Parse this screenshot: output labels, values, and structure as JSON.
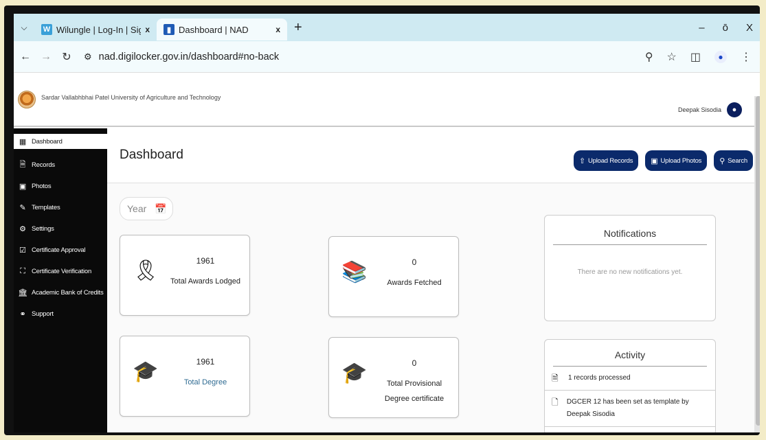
{
  "browser": {
    "tabs": [
      {
        "title": "Wilungle | Log-In | Sign-Up",
        "close": "x",
        "active": false
      },
      {
        "title": "Dashboard | NAD",
        "close": "x",
        "active": true
      }
    ],
    "new_tab": "+",
    "window_controls": [
      "–",
      "ō",
      "X"
    ],
    "url": "nad.digilocker.gov.in/dashboard#no-back"
  },
  "header": {
    "university": "Sardar Vallabhbhai Patel University of Agriculture and Technology",
    "user_name": "Deepak Sisodia"
  },
  "sidebar": {
    "items": [
      {
        "label": "Dashboard",
        "icon": "dashboard-icon",
        "active": true
      },
      {
        "label": "Records",
        "icon": "file-icon"
      },
      {
        "label": "Photos",
        "icon": "image-icon"
      },
      {
        "label": "Templates",
        "icon": "pencil-icon"
      },
      {
        "label": "Settings",
        "icon": "gear-icon"
      },
      {
        "label": "Certificate Approval",
        "icon": "certificate-icon"
      },
      {
        "label": "Certificate Verification",
        "icon": "verify-icon"
      },
      {
        "label": "Academic Bank of Credits",
        "icon": "bank-icon"
      },
      {
        "label": "Support",
        "icon": "headset-icon"
      }
    ]
  },
  "main": {
    "title": "Dashboard",
    "actions": {
      "upload_records": "Upload Records",
      "upload_photos": "Upload Photos",
      "search": "Search"
    },
    "year_placeholder": "Year",
    "cards": [
      {
        "value": "1961",
        "label": "Total Awards Lodged",
        "icon": "award-ribbon-icon"
      },
      {
        "value": "0",
        "label": "Awards Fetched",
        "icon": "books-icon"
      },
      {
        "value": "1961",
        "label": "Total Degree",
        "icon": "graduation-cap-icon"
      },
      {
        "value": "0",
        "label": "Total Provisional Degree certificate",
        "icon": "graduation-cap-icon"
      }
    ]
  },
  "notifications": {
    "title": "Notifications",
    "empty": "There are no new notifications yet."
  },
  "activity": {
    "title": "Activity",
    "items": [
      {
        "text": "1 records processed",
        "icon": "file-icon"
      },
      {
        "text": "DGCER 12 has been set as template by Deepak Sisodia",
        "icon": "document-icon"
      }
    ]
  },
  "colors": {
    "tabbar_bg": "#cfeaf2",
    "sidebar_bg": "#0a0a0a",
    "button_bg": "#0b2a6b",
    "link_text": "#2f6b92"
  }
}
